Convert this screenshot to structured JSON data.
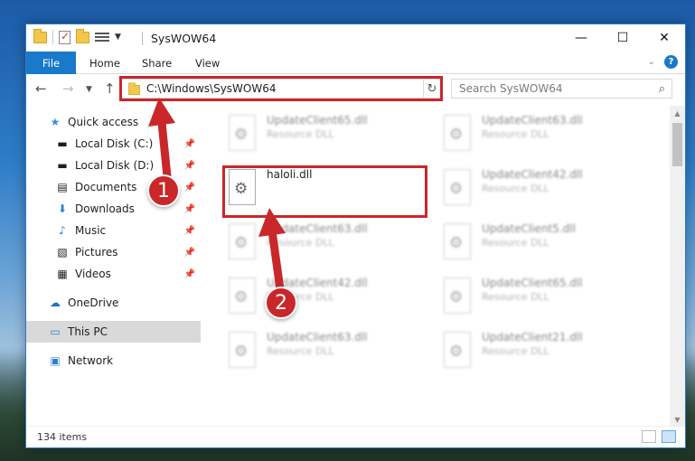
{
  "window": {
    "title": "SysWOW64"
  },
  "ribbon": {
    "tabs": [
      "File",
      "Home",
      "Share",
      "View"
    ]
  },
  "window_buttons": {
    "minimize": "—",
    "maximize": "☐",
    "close": "✕"
  },
  "address": {
    "path": "C:\\Windows\\SysWOW64"
  },
  "search": {
    "placeholder": "Search SysWOW64"
  },
  "sidebar": {
    "quick_access": "Quick access",
    "items": [
      {
        "label": "Local Disk (C:)",
        "icon": "drive-icon"
      },
      {
        "label": "Local Disk (D:)",
        "icon": "drive-icon"
      },
      {
        "label": "Documents",
        "icon": "documents-icon"
      },
      {
        "label": "Downloads",
        "icon": "downloads-icon"
      },
      {
        "label": "Music",
        "icon": "music-icon"
      },
      {
        "label": "Pictures",
        "icon": "pictures-icon"
      },
      {
        "label": "Videos",
        "icon": "videos-icon"
      }
    ],
    "onedrive": "OneDrive",
    "this_pc": "This PC",
    "network": "Network"
  },
  "files": {
    "highlighted": {
      "name": "haloli.dll"
    },
    "left": [
      {
        "name": "UpdateClient65.dll",
        "type": "Resource DLL"
      },
      {
        "name": "UpdateClient63.dll",
        "type": "Resource DLL"
      },
      {
        "name": "UpdateClient42.dll",
        "type": "Resource DLL"
      },
      {
        "name": "UpdateClient63.dll",
        "type": "Resource DLL"
      }
    ],
    "right": [
      {
        "name": "UpdateClient63.dll",
        "type": "Resource DLL"
      },
      {
        "name": "UpdateClient42.dll",
        "type": "Resource DLL"
      },
      {
        "name": "UpdateClient5.dll",
        "type": "Resource DLL"
      },
      {
        "name": "UpdateClient65.dll",
        "type": "Resource DLL"
      },
      {
        "name": "UpdateClient21.dll",
        "type": "Resource DLL"
      }
    ]
  },
  "status": {
    "item_count": "134 items"
  },
  "annotations": {
    "step1": "1",
    "step2": "2",
    "color": "#c9272a"
  }
}
